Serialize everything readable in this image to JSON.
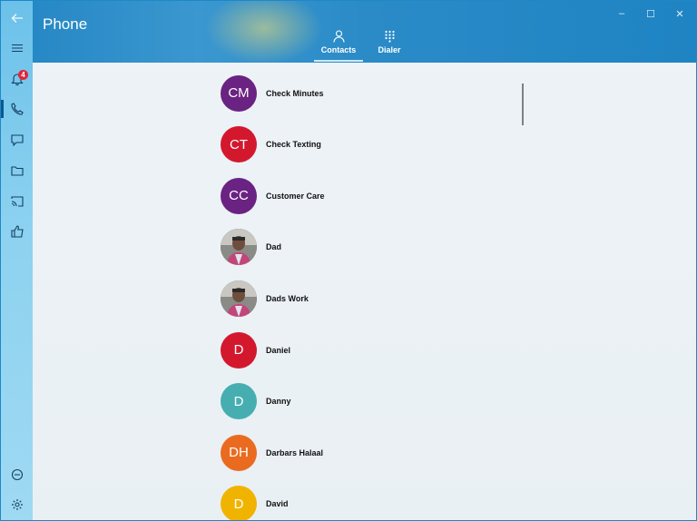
{
  "app": {
    "title": "Phone"
  },
  "window_controls": {
    "minimize": "–",
    "maximize": "☐",
    "close": "✕"
  },
  "sidebar": {
    "notifications_badge": "4"
  },
  "tabs": [
    {
      "label": "Contacts",
      "icon": "person-icon",
      "active": true
    },
    {
      "label": "Dialer",
      "icon": "dialpad-icon",
      "active": false
    }
  ],
  "contacts": [
    {
      "name": "Check Minutes",
      "initials": "CM",
      "color": "#6a2382",
      "photo": false
    },
    {
      "name": "Check Texting",
      "initials": "CT",
      "color": "#d3182d",
      "photo": false
    },
    {
      "name": "Customer Care",
      "initials": "CC",
      "color": "#6a2382",
      "photo": false
    },
    {
      "name": "Dad",
      "initials": "",
      "color": "#6b6b6b",
      "photo": true
    },
    {
      "name": "Dads Work",
      "initials": "",
      "color": "#6b6b6b",
      "photo": true
    },
    {
      "name": "Daniel",
      "initials": "D",
      "color": "#d3182d",
      "photo": false
    },
    {
      "name": "Danny",
      "initials": "D",
      "color": "#46aeb0",
      "photo": false
    },
    {
      "name": "Darbars Halaal",
      "initials": "DH",
      "color": "#ea6b1f",
      "photo": false
    },
    {
      "name": "David",
      "initials": "D",
      "color": "#f0b400",
      "photo": false
    }
  ]
}
